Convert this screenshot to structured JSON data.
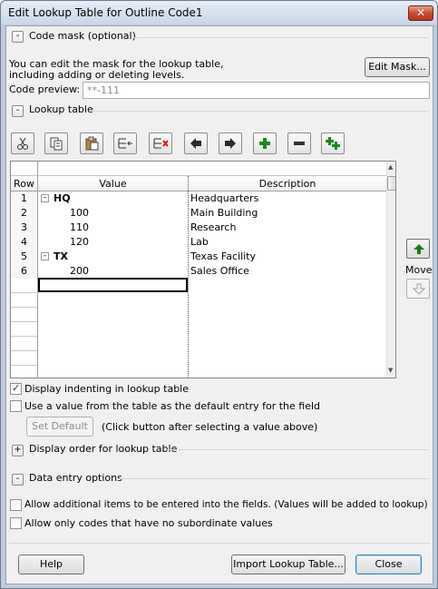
{
  "window": {
    "title": "Edit Lookup Table for Outline Code1",
    "close_glyph": "✕"
  },
  "sections": {
    "code_mask": {
      "toggle": "-",
      "label": "Code mask (optional)"
    },
    "lookup_table": {
      "toggle": "-",
      "label": "Lookup table"
    },
    "display_order": {
      "toggle": "+",
      "label": "Display order for lookup table"
    },
    "data_entry": {
      "toggle": "-",
      "label": "Data entry options"
    }
  },
  "mask": {
    "description_line1": "You can edit the mask for the lookup table,",
    "description_line2": "including adding or deleting levels.",
    "edit_button": "Edit Mask...",
    "preview_label": "Code preview:",
    "preview_value": "**-111"
  },
  "toolbar": {
    "icons": [
      "cut-icon",
      "copy-icon",
      "paste-icon",
      "insert-row-icon",
      "delete-row-icon",
      "outdent-icon",
      "indent-icon",
      "expand-icon",
      "collapse-icon",
      "expand-all-icon"
    ]
  },
  "table": {
    "headers": {
      "row": "Row",
      "value": "Value",
      "description": "Description"
    },
    "rows": [
      {
        "row": "1",
        "value": "HQ",
        "description": "Headquarters",
        "level": 0,
        "toggle": "-"
      },
      {
        "row": "2",
        "value": "100",
        "description": "Main Building",
        "level": 1,
        "toggle": ""
      },
      {
        "row": "3",
        "value": "110",
        "description": "Research",
        "level": 1,
        "toggle": ""
      },
      {
        "row": "4",
        "value": "120",
        "description": "Lab",
        "level": 1,
        "toggle": ""
      },
      {
        "row": "5",
        "value": "TX",
        "description": "Texas Facility",
        "level": 0,
        "toggle": "-"
      },
      {
        "row": "6",
        "value": "200",
        "description": "Sales Office",
        "level": 1,
        "toggle": ""
      }
    ]
  },
  "move": {
    "label": "Move"
  },
  "options": {
    "display_indenting": {
      "label": "Display indenting in lookup table",
      "checked": true
    },
    "use_default": {
      "label": "Use a value from the table as the default entry for the field",
      "checked": false
    },
    "set_default_button": "Set Default",
    "set_default_hint": "(Click button after selecting a value above)",
    "allow_additional": {
      "label": "Allow additional items to be entered into the fields. (Values will be added to lookup)",
      "checked": false
    },
    "allow_only_codes": {
      "label": "Allow only codes that have no subordinate values",
      "checked": false
    }
  },
  "footer": {
    "help": "Help",
    "import": "Import Lookup Table...",
    "close": "Close"
  }
}
